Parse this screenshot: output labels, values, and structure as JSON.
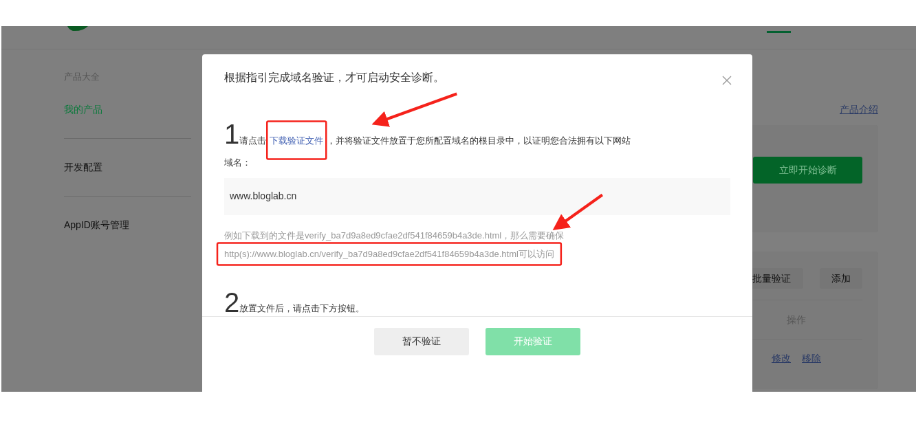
{
  "sidebar": {
    "items": [
      {
        "label": "产品大全",
        "kind": "heading"
      },
      {
        "label": "我的产品",
        "kind": "link",
        "selected": true
      },
      {
        "label": "开发配置",
        "kind": "link",
        "selected": false
      },
      {
        "label": "AppID账号管理",
        "kind": "link",
        "selected": false
      }
    ]
  },
  "content": {
    "intro_link": "产品介绍",
    "start_button": "立即开始诊断",
    "toolbar_buttons": [
      "批量验证",
      "添加"
    ],
    "table": {
      "columns": [
        "操作"
      ],
      "rows": [
        {
          "actions": [
            "修改",
            "移除"
          ]
        }
      ]
    }
  },
  "dialog": {
    "title": "根据指引完成域名验证，才可启动安全诊断。",
    "steps": [
      {
        "number": "1",
        "text_before": "请点击",
        "link": "下载验证文件",
        "text_after": "，并将验证文件放置于您所配置域名的根目录中，以证明您合法拥有以下网站"
      },
      {
        "number": "2",
        "text_before": "放置文件后，请点击下方按钮。"
      }
    ],
    "domain_label": "域名：",
    "domain": "www.bloglab.cn",
    "hint_lines": [
      "例如下载到的文件是verify_ba7d9a8ed9cfae2df541f84659b4a3de.html，那么需要确保",
      "http(s)://www.bloglab.cn/verify_ba7d9a8ed9cfae2df541f84659b4a3de.html可以访问"
    ],
    "buttons": [
      {
        "label": "暂不验证",
        "kind": "secondary",
        "disabled": false
      },
      {
        "label": "开始验证",
        "kind": "primary",
        "disabled": true
      }
    ]
  }
}
